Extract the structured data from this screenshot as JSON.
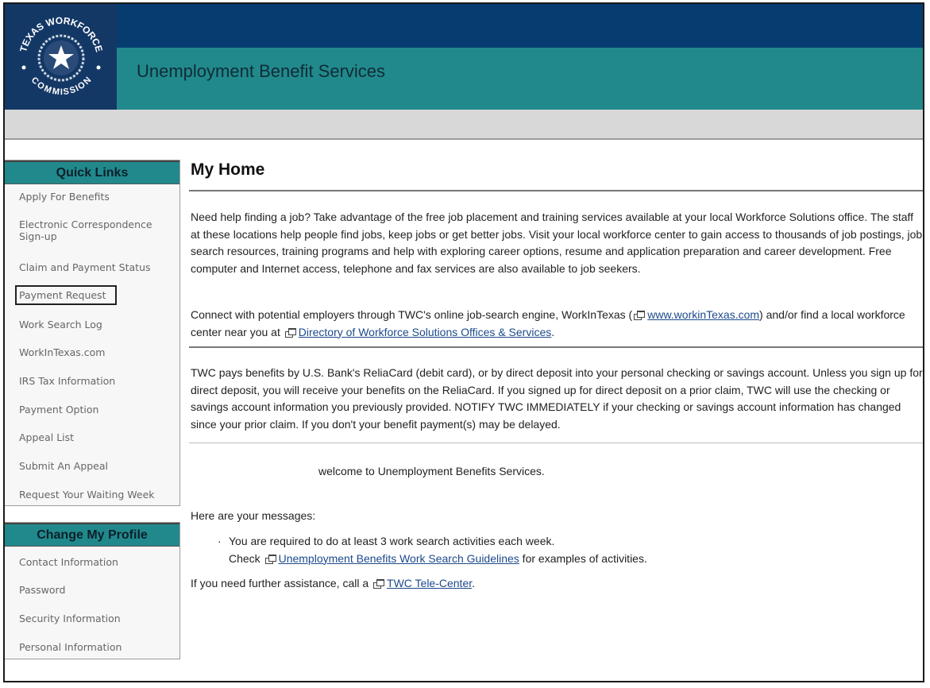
{
  "header": {
    "app_title": "Unemployment Benefit Services",
    "logo_text_top": "TEXAS WORKFORCE",
    "logo_text_bottom": "COMMISSION",
    "colors": {
      "navy": "#073c70",
      "teal": "#21898c",
      "logo_bg": "#143866",
      "gray_bar": "#d8d8d8"
    }
  },
  "sidebar": {
    "quick_links": {
      "title": "Quick Links",
      "items": [
        {
          "label": "Apply For Benefits"
        },
        {
          "label": "Electronic Correspondence Sign-up"
        },
        {
          "label": "Claim and Payment Status"
        },
        {
          "label": "Payment Request"
        },
        {
          "label": "Work Search Log"
        },
        {
          "label": "WorkInTexas.com"
        },
        {
          "label": "IRS Tax Information"
        },
        {
          "label": "Payment Option"
        },
        {
          "label": "Appeal List"
        },
        {
          "label": "Submit An Appeal"
        },
        {
          "label": "Request Your Waiting Week"
        }
      ]
    },
    "profile": {
      "title": "Change My Profile",
      "items": [
        {
          "label": "Contact Information"
        },
        {
          "label": "Password"
        },
        {
          "label": "Security Information"
        },
        {
          "label": "Personal Information"
        }
      ]
    }
  },
  "main": {
    "title": "My Home",
    "job_help_text": "Need help finding a job? Take advantage of the free job placement and training services available at your local Workforce Solutions office. The staff at these locations help people find jobs, keep jobs or get better jobs. Visit your local workforce center to gain access to thousands of job postings, job search resources, training programs and help with exploring career options, resume and application preparation and career development. Free computer and Internet access, telephone and fax services are also available to job seekers.",
    "connect": {
      "before": "Connect with potential employers through TWC's online job-search engine, WorkInTexas (",
      "link1": "www.workinTexas.com",
      "middle": ") and/or find a local workforce center near you at ",
      "link2": "Directory of Workforce Solutions Offices & Services",
      "after": "."
    },
    "payment_text": "TWC pays benefits by U.S. Bank's ReliaCard (debit card), or by direct deposit into your personal checking or savings account. Unless you sign up for direct deposit, you will receive your benefits on the ReliaCard. If you signed up for direct deposit on a prior claim, TWC will use the checking or savings account information you previously provided. NOTIFY TWC IMMEDIATELY if your checking or savings account information has changed since your prior claim. If you don't your benefit payment(s) may be delayed.",
    "welcome": "welcome to Unemployment Benefits Services.",
    "messages_intro": "Here are your messages:",
    "message_item": {
      "line1": "You are required to do at least 3 work search activities each week.",
      "check": "Check ",
      "link": "Unemployment Benefits Work Search Guidelines",
      "after": " for examples of activities."
    },
    "assistance": {
      "before": "If you need further assistance, call a ",
      "link": "TWC Tele-Center",
      "after": "."
    }
  }
}
